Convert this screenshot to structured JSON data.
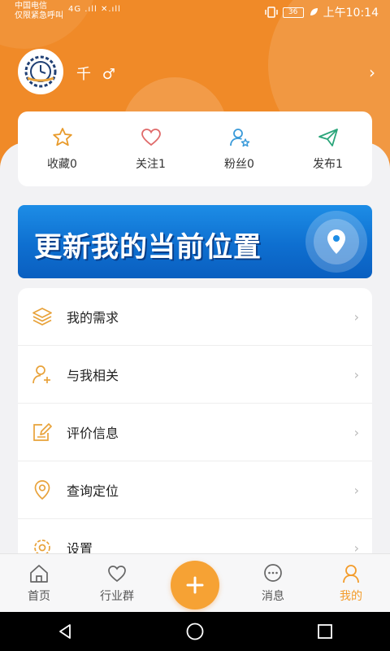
{
  "status_bar": {
    "carrier_line1": "中国电信",
    "carrier_line2": "仅限紧急呼叫",
    "signal_text": "4G .ıll ✕.ıll",
    "battery": "36",
    "time": "上午10:14"
  },
  "profile": {
    "username": "千",
    "gender_symbol": "♂",
    "chevron": "›",
    "avatar_icon": "gear-clock-logo"
  },
  "stats": [
    {
      "label": "收藏0",
      "icon": "star-icon",
      "color": "#e89a2a"
    },
    {
      "label": "关注1",
      "icon": "heart-icon",
      "color": "#e06a6a"
    },
    {
      "label": "粉丝0",
      "icon": "user-star-icon",
      "color": "#3a9ad9"
    },
    {
      "label": "发布1",
      "icon": "send-icon",
      "color": "#2aa57a"
    }
  ],
  "banner": {
    "text": "更新我的当前位置",
    "icon": "location-pin-icon"
  },
  "menu": [
    {
      "label": "我的需求",
      "icon": "layers-icon"
    },
    {
      "label": "与我相关",
      "icon": "user-add-icon"
    },
    {
      "label": "评价信息",
      "icon": "edit-icon"
    },
    {
      "label": "查询定位",
      "icon": "location-icon"
    },
    {
      "label": "设置",
      "icon": "gear-icon"
    }
  ],
  "menu_chevron": "›",
  "tabbar": {
    "home": "首页",
    "groups": "行业群",
    "messages": "消息",
    "mine": "我的",
    "accent": "#f39c2b"
  },
  "colors": {
    "header_orange": "#f08a28",
    "accent": "#f39c2b",
    "banner_blue": "#1d8de6"
  }
}
